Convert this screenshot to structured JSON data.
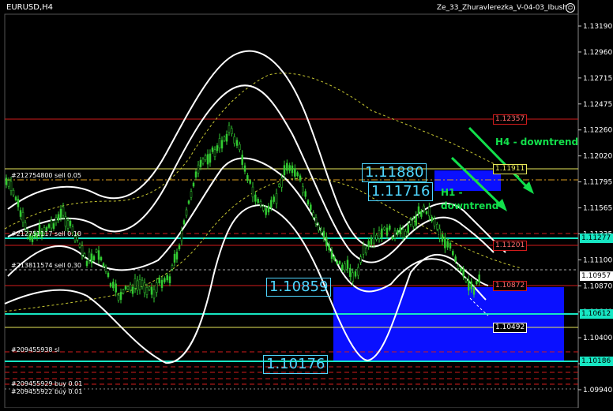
{
  "window": {
    "symbol_title": "EURUSD,H4",
    "indicator_name": "Ze_33_Zhuravlerezka_V-04-03_Ibush"
  },
  "price_axis": {
    "ticks": [
      "1.13190",
      "1.12960",
      "1.12715",
      "1.12475",
      "1.12260",
      "1.12020",
      "1.11795",
      "1.11565",
      "1.11335",
      "1.11100",
      "1.10870",
      "1.10640",
      "1.10400",
      "1.10170",
      "1.09940"
    ],
    "current_price": "1.10957",
    "tag_11277": "1.11277",
    "tag_10612": "1.10612",
    "tag_10186": "1.10186"
  },
  "levels": {
    "l12357": "1.12357",
    "l11911": "1.11911",
    "l11201": "1.11201",
    "l10872": "1.10872",
    "l10492": "1.10492"
  },
  "boxes": {
    "b11880": "1.11880",
    "b11716": "1.11716",
    "b10859": "1.10859",
    "b10176": "1.10176"
  },
  "annotations": {
    "h4": "H4 - downtrend",
    "h1_line1": "H1 -",
    "h1_line2": "downtrend"
  },
  "orders": {
    "o1": "#212754800 sell 0.05",
    "o2": "#212751117 sell 0.10",
    "o3": "#213811574 sell 0.30",
    "o4": "#209455938 sl",
    "o5": "#209455929 buy 0.01",
    "o6": "#209455922 buy 0.01"
  },
  "colors": {
    "background": "#000000",
    "red_level": "#d21b1b",
    "yellow_level": "#e8e85a",
    "cyan_level": "#17e6c3",
    "box_blue": "#0a10ff",
    "label_cyan": "#4fd6ff",
    "annotation_green": "#12e04b",
    "candles": "#33cc33"
  }
}
